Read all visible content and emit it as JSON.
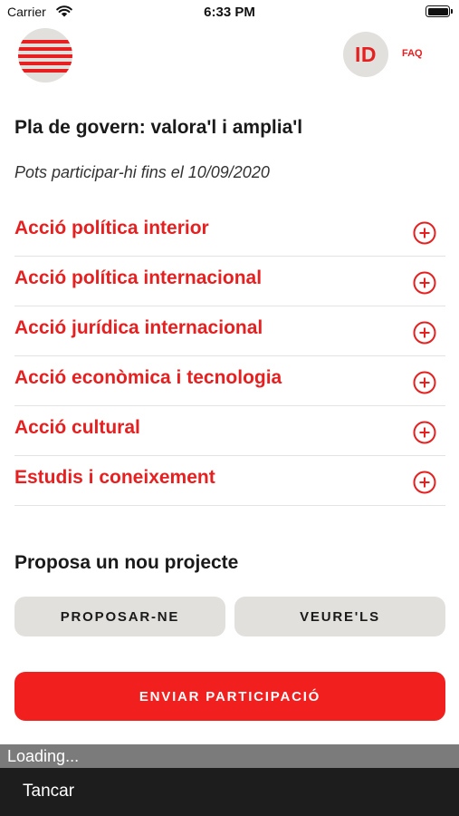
{
  "status_bar": {
    "carrier": "Carrier",
    "time": "6:33 PM",
    "icons": [
      "wifi-icon",
      "battery-icon"
    ]
  },
  "header": {
    "logo_icon": "striped-circle-logo",
    "id_label": "ID",
    "faq_label": "FAQ"
  },
  "main": {
    "title": "Pla de govern: valora'l i amplia'l",
    "deadline": "Pots participar-hi fins el 10/09/2020",
    "categories": [
      {
        "label": "Acció política interior",
        "icon": "plus-circle-icon"
      },
      {
        "label": "Acció política internacional",
        "icon": "plus-circle-icon"
      },
      {
        "label": "Acció jurídica internacional",
        "icon": "plus-circle-icon"
      },
      {
        "label": "Acció econòmica i tecnologia",
        "icon": "plus-circle-icon"
      },
      {
        "label": "Acció cultural",
        "icon": "plus-circle-icon"
      },
      {
        "label": "Estudis i coneixement",
        "icon": "plus-circle-icon"
      }
    ]
  },
  "proposal": {
    "title": "Proposa un nou projecte",
    "propose_label": "PROPOSAR-NE",
    "view_label": "VEURE'LS"
  },
  "submit_label": "ENVIAR PARTICIPACIÓ",
  "loading_text": "Loading...",
  "close_label": "Tancar",
  "colors": {
    "accent": "#e62020",
    "submit_bg": "#f21f1f",
    "button_gray": "#e2e0dd",
    "loading_bg": "#7b7b7b",
    "bottom_bar_bg": "#1d1d1d"
  }
}
